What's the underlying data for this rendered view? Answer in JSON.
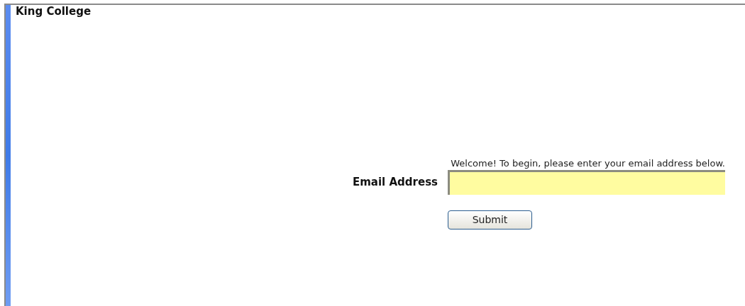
{
  "header": {
    "title": "King College"
  },
  "form": {
    "intro": "Welcome! To begin, please enter your email address below.",
    "email_label": "Email Address",
    "submit": "Submit"
  }
}
